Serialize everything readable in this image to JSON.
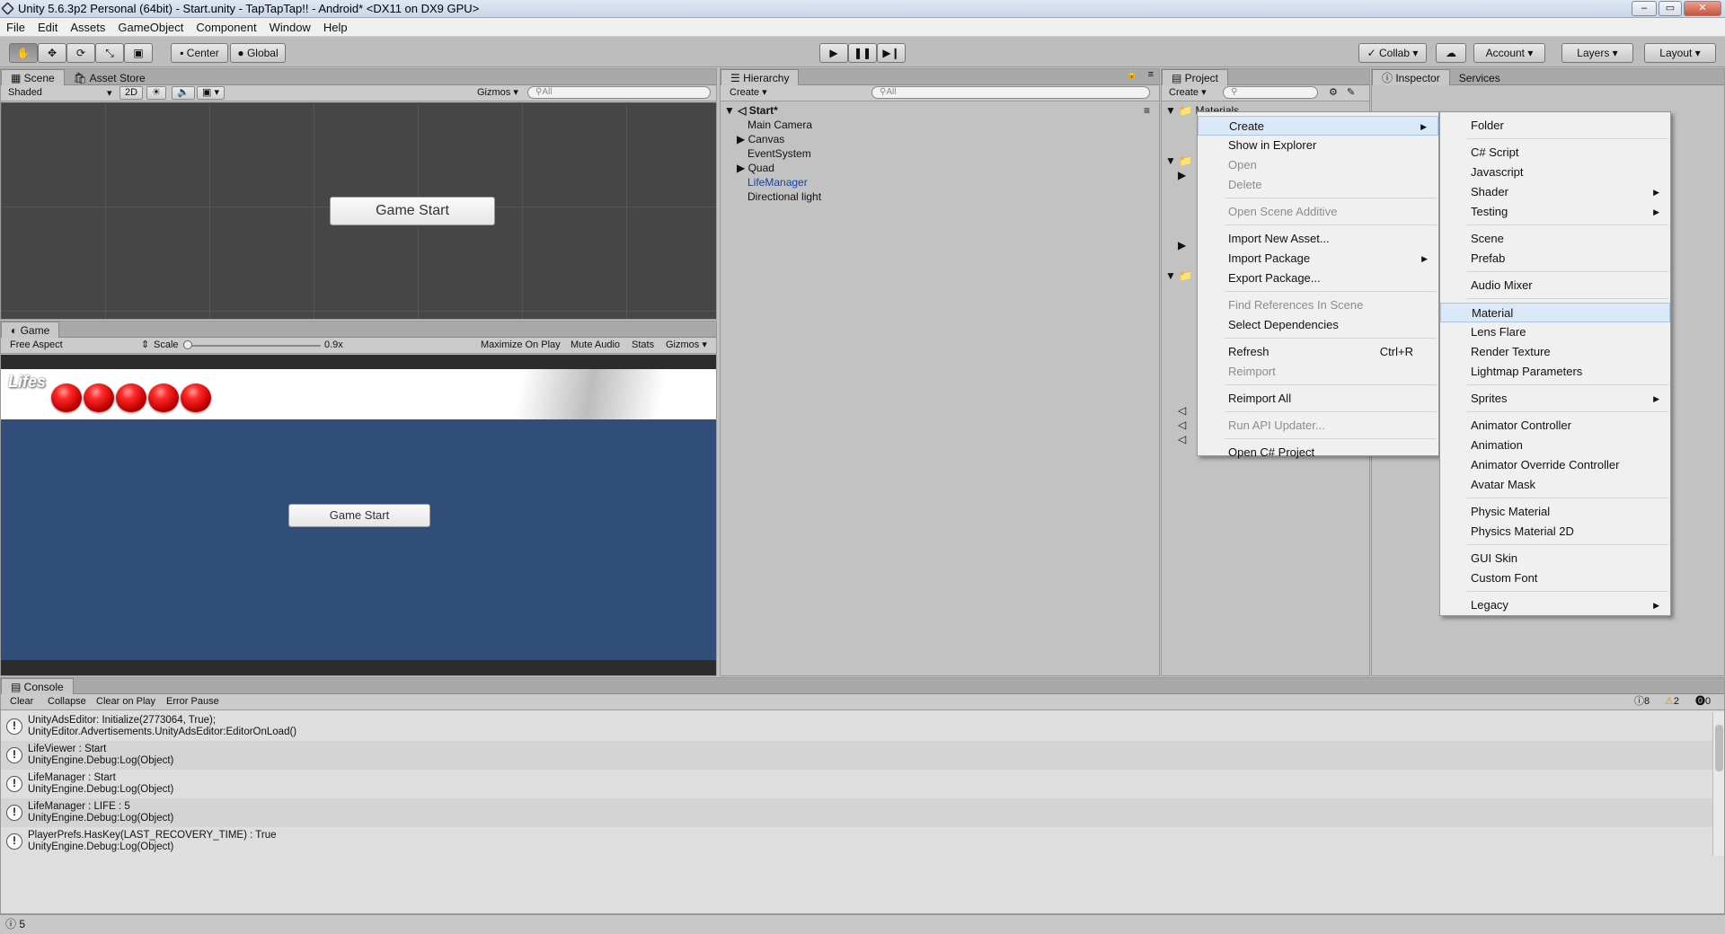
{
  "window": {
    "title": "Unity 5.6.3p2 Personal (64bit) - Start.unity - TapTapTap!! - Android* <DX11 on DX9 GPU>"
  },
  "menu": [
    "File",
    "Edit",
    "Assets",
    "GameObject",
    "Component",
    "Window",
    "Help"
  ],
  "toolbar": {
    "center": "Center",
    "global": "Global",
    "collab": "Collab",
    "account": "Account",
    "layers": "Layers",
    "layout": "Layout"
  },
  "scene": {
    "tab": "Scene",
    "asset_store_tab": "Asset Store",
    "shading": "Shaded",
    "mode2d": "2D",
    "gizmos": "Gizmos",
    "search": "All",
    "button": "Game Start"
  },
  "game": {
    "tab": "Game",
    "aspect": "Free Aspect",
    "scale_label": "Scale",
    "scale_value": "0.9x",
    "maximize": "Maximize On Play",
    "mute": "Mute Audio",
    "stats": "Stats",
    "gizmos": "Gizmos",
    "lifes_label": "Lifes",
    "life_count": 5,
    "button": "Game Start"
  },
  "hierarchy": {
    "tab": "Hierarchy",
    "create": "Create",
    "search": "All",
    "scene_name": "Start*",
    "items": [
      "Main Camera",
      "Canvas",
      "EventSystem",
      "Quad",
      "LifeManager",
      "Directional light"
    ]
  },
  "project": {
    "tab": "Project",
    "create": "Create",
    "folder_partial": "Materials"
  },
  "inspector": {
    "tab": "Inspector",
    "services_tab": "Services"
  },
  "context_menu": {
    "items": [
      {
        "label": "Create",
        "state": "highlight",
        "arrow": true
      },
      {
        "label": "Show in Explorer"
      },
      {
        "label": "Open",
        "state": "disabled"
      },
      {
        "label": "Delete",
        "state": "disabled"
      },
      {
        "label": "Open Scene Additive",
        "state": "disabled"
      },
      {
        "label": "Import New Asset..."
      },
      {
        "label": "Import Package",
        "arrow": true
      },
      {
        "label": "Export Package..."
      },
      {
        "label": "Find References In Scene",
        "state": "disabled"
      },
      {
        "label": "Select Dependencies"
      },
      {
        "label": "Refresh",
        "shortcut": "Ctrl+R"
      },
      {
        "label": "Reimport",
        "state": "disabled"
      },
      {
        "label": "Reimport All"
      },
      {
        "label": "Run API Updater...",
        "state": "disabled"
      },
      {
        "label": "Open C# Project"
      }
    ]
  },
  "create_submenu": {
    "items": [
      {
        "label": "Folder"
      },
      {
        "label": "C# Script"
      },
      {
        "label": "Javascript"
      },
      {
        "label": "Shader",
        "arrow": true
      },
      {
        "label": "Testing",
        "arrow": true
      },
      {
        "label": "Scene"
      },
      {
        "label": "Prefab"
      },
      {
        "label": "Audio Mixer"
      },
      {
        "label": "Material",
        "state": "highlight"
      },
      {
        "label": "Lens Flare"
      },
      {
        "label": "Render Texture"
      },
      {
        "label": "Lightmap Parameters"
      },
      {
        "label": "Sprites",
        "arrow": true
      },
      {
        "label": "Animator Controller"
      },
      {
        "label": "Animation"
      },
      {
        "label": "Animator Override Controller"
      },
      {
        "label": "Avatar Mask"
      },
      {
        "label": "Physic Material"
      },
      {
        "label": "Physics Material 2D"
      },
      {
        "label": "GUI Skin"
      },
      {
        "label": "Custom Font"
      },
      {
        "label": "Legacy",
        "arrow": true
      }
    ]
  },
  "console": {
    "tab": "Console",
    "clear": "Clear",
    "collapse": "Collapse",
    "clear_on_play": "Clear on Play",
    "error_pause": "Error Pause",
    "info_count": "8",
    "warn_count": "2",
    "error_count": "0",
    "entries": [
      {
        "line1": "UnityAdsEditor: Initialize(2773064, True);",
        "line2": "UnityEditor.Advertisements.UnityAdsEditor:EditorOnLoad()"
      },
      {
        "line1": "LifeViewer : Start",
        "line2": "UnityEngine.Debug:Log(Object)"
      },
      {
        "line1": "LifeManager : Start",
        "line2": "UnityEngine.Debug:Log(Object)"
      },
      {
        "line1": "LifeManager : LIFE : 5",
        "line2": "UnityEngine.Debug:Log(Object)"
      },
      {
        "line1": "PlayerPrefs.HasKey(LAST_RECOVERY_TIME) : True",
        "line2": "UnityEngine.Debug:Log(Object)"
      }
    ]
  },
  "statusbar": {
    "text": "5"
  }
}
